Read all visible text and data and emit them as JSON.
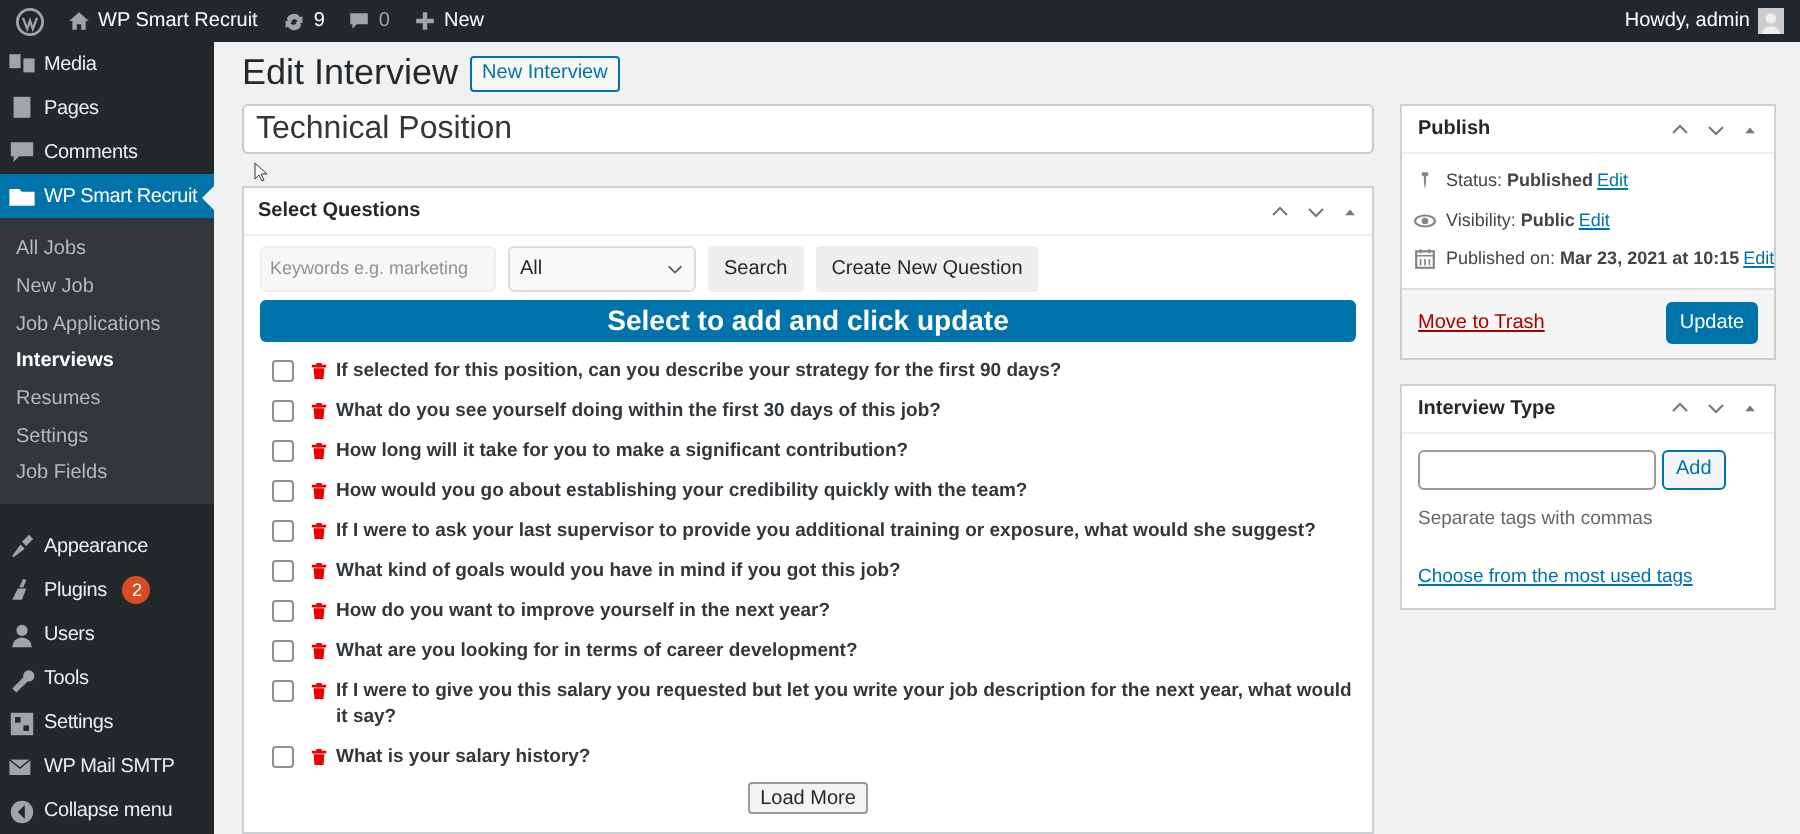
{
  "admin_bar": {
    "site": "WP Smart Recruit",
    "updates": "9",
    "comments": "0",
    "new": "New",
    "greeting": "Howdy, admin"
  },
  "sidebar": {
    "items": [
      {
        "label": "Media",
        "selected": false
      },
      {
        "label": "Pages",
        "selected": false
      },
      {
        "label": "Comments",
        "selected": false
      },
      {
        "label": "WP Smart Recruit",
        "selected": true,
        "children": [
          {
            "label": "All Jobs",
            "selected": false
          },
          {
            "label": "New Job",
            "selected": false
          },
          {
            "label": "Job Applications",
            "selected": false
          },
          {
            "label": "Interviews",
            "selected": true
          },
          {
            "label": "Resumes",
            "selected": false
          },
          {
            "label": "Settings",
            "selected": false
          },
          {
            "label": "Job Fields",
            "selected": false
          }
        ]
      },
      {
        "label": "Appearance",
        "selected": false
      },
      {
        "label": "Plugins",
        "selected": false,
        "badge": "2"
      },
      {
        "label": "Users",
        "selected": false
      },
      {
        "label": "Tools",
        "selected": false
      },
      {
        "label": "Settings",
        "selected": false
      },
      {
        "label": "WP Mail SMTP",
        "selected": false
      },
      {
        "label": "Collapse menu",
        "selected": false
      }
    ]
  },
  "page": {
    "title": "Edit Interview",
    "new_button": "New Interview",
    "post_title": "Technical Position"
  },
  "questions_box": {
    "title": "Select Questions",
    "search": {
      "placeholder": "Keywords e.g. marketing"
    },
    "category": "All",
    "search_button": "Search",
    "create_button": "Create New Question",
    "banner": "Select to add and click update",
    "questions": [
      {
        "text": "If selected for this position, can you describe your strategy for the first 90 days?",
        "checked": false
      },
      {
        "text": "What do you see yourself doing within the first 30 days of this job?",
        "checked": false
      },
      {
        "text": "How long will it take for you to make a significant contribution?",
        "checked": false
      },
      {
        "text": "How would you go about establishing your credibility quickly with the team?",
        "checked": false
      },
      {
        "text": "If I were to ask your last supervisor to provide you additional training or exposure, what would she suggest?",
        "checked": false
      },
      {
        "text": "What kind of goals would you have in mind if you got this job?",
        "checked": false
      },
      {
        "text": "How do you want to improve yourself in the next year?",
        "checked": false
      },
      {
        "text": "What are you looking for in terms of career development?",
        "checked": false
      },
      {
        "text": "If I were to give you this salary you requested but let you write your job description for the next year, what would it say?",
        "checked": false
      },
      {
        "text": "What is your salary history?",
        "checked": false
      }
    ],
    "load_more": "Load More"
  },
  "publish": {
    "title": "Publish",
    "rows": [
      {
        "label": "Status:",
        "value": "Published",
        "link": "Edit"
      },
      {
        "label": "Visibility:",
        "value": "Public",
        "link": "Edit"
      },
      {
        "label": "Published on:",
        "value": "Mar 23, 2021 at 10:15",
        "link": "Edit"
      }
    ],
    "trash": "Move to Trash",
    "update": "Update"
  },
  "interview_type": {
    "title": "Interview Type",
    "add": "Add",
    "hint": "Separate tags with commas",
    "link": "Choose from the most used tags"
  }
}
